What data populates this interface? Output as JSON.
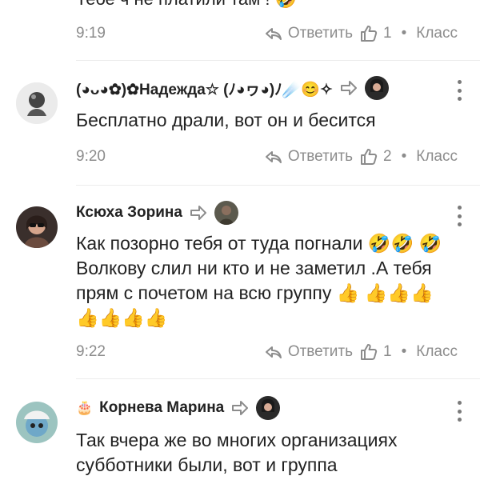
{
  "top_cut_text": "Тебе ч не платили там ! 🤣",
  "comments": [
    {
      "time": "9:19",
      "reply": "Ответить",
      "likes": "1",
      "klass": "Класс"
    },
    {
      "author": "(◕ᴗ◕✿)✿Надежда☆ (ﾉ◕ヮ◕)ﾉ☄️😊✧",
      "text": "Бесплатно драли, вот он и бесится",
      "time": "9:20",
      "reply": "Ответить",
      "likes": "2",
      "klass": "Класс"
    },
    {
      "author": "Ксюха Зорина",
      "text": "Как позорно тебя от туда погнали 🤣🤣 🤣Волкову слил ни кто и не заметил .А тебя прям с почетом на всю группу 👍 👍👍👍👍👍👍👍",
      "time": "9:22",
      "reply": "Ответить",
      "likes": "1",
      "klass": "Класс"
    },
    {
      "badge": "🎂",
      "author": "Корнева Марина",
      "text": "Так вчера же во многих организациях субботники были, вот и группа"
    }
  ],
  "icons": {
    "reply": "reply-arrow-icon",
    "like": "thumbs-up-icon",
    "more": "more-vertical-icon",
    "reply_to": "reply-to-arrow-icon"
  },
  "colors": {
    "meta": "#8c8c8c",
    "text": "#222222",
    "divider": "#ececec"
  }
}
